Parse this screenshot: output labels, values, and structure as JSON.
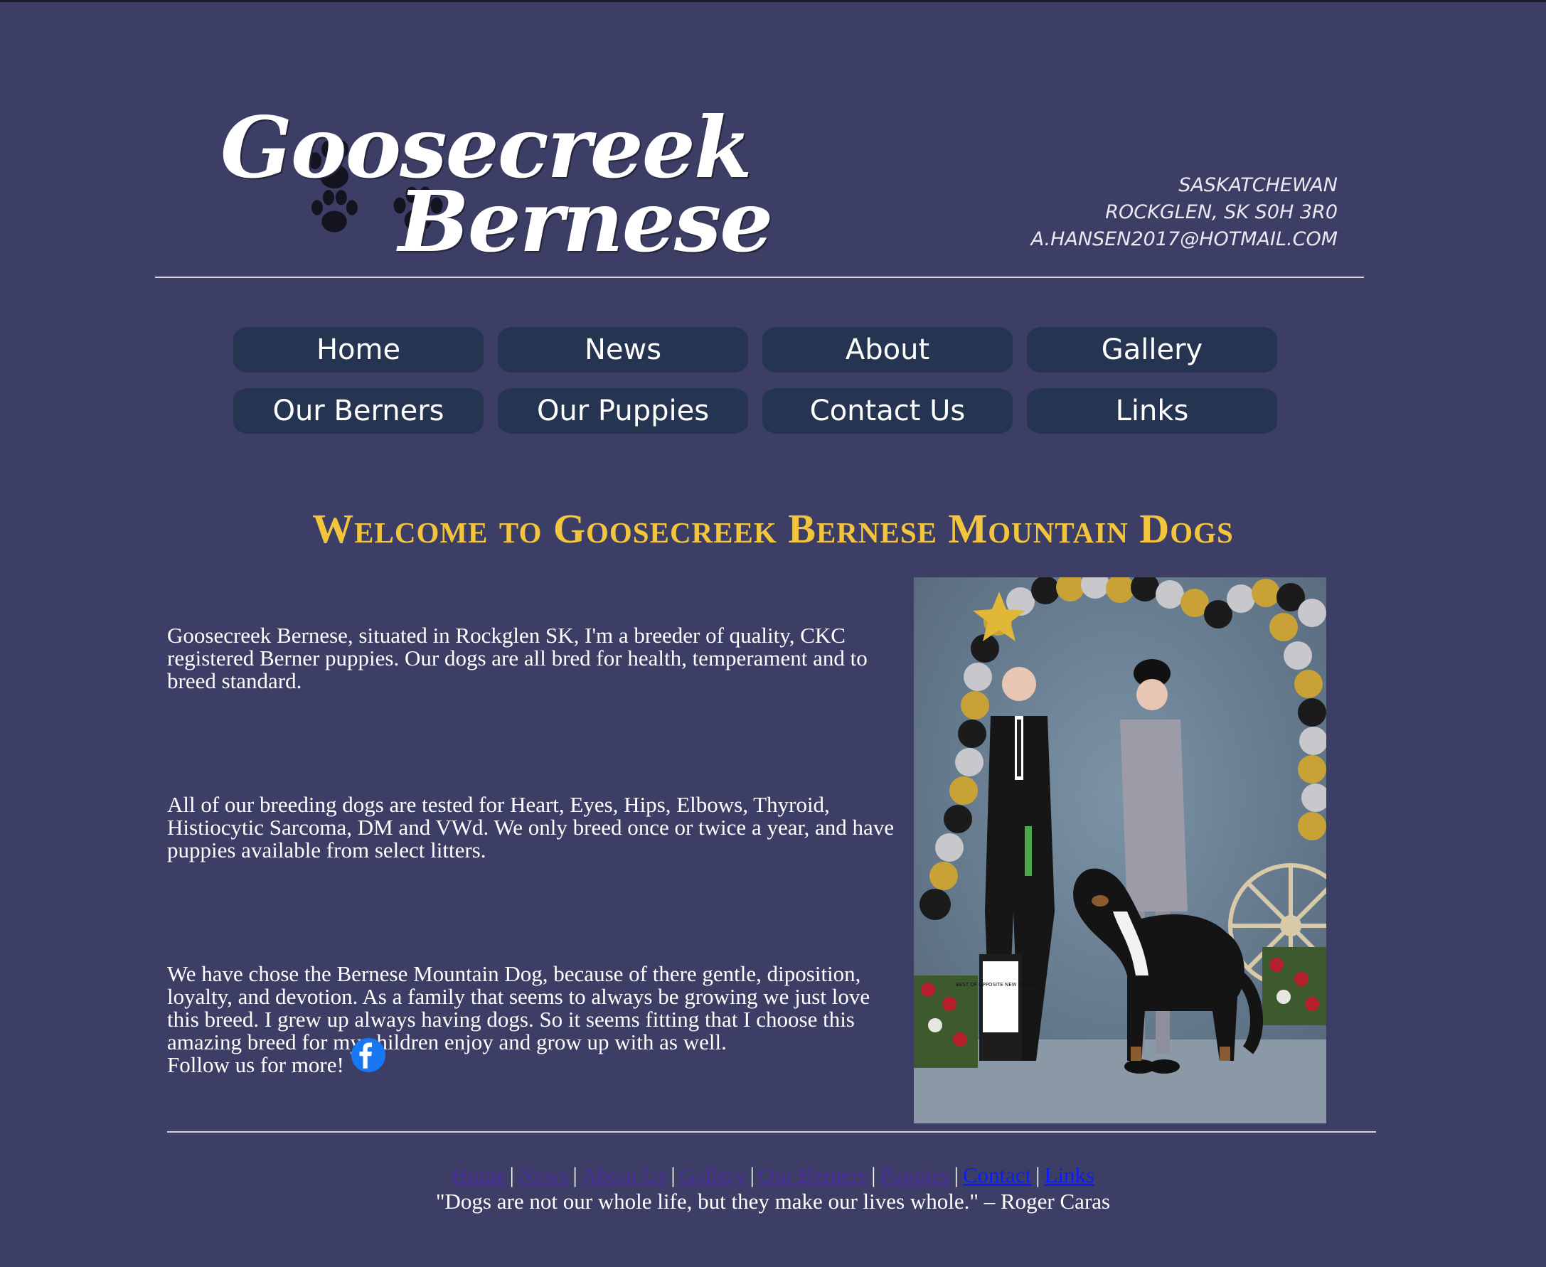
{
  "logo": {
    "line1": "Goosecreek",
    "line2": "Bernese",
    "paw_icon": "paw-print-icon"
  },
  "address": {
    "line1": "SASKATCHEWAN",
    "line2": "ROCKGLEN, SK S0H 3R0",
    "line3": "A.HANSEN2017@HOTMAIL.COM"
  },
  "nav": {
    "items": [
      {
        "label": "Home"
      },
      {
        "label": "News"
      },
      {
        "label": "About"
      },
      {
        "label": "Gallery"
      },
      {
        "label": "Our Berners"
      },
      {
        "label": "Our Puppies"
      },
      {
        "label": "Contact Us"
      },
      {
        "label": "Links"
      }
    ],
    "button_color": "#253450"
  },
  "main": {
    "heading": "Welcome to Goosecreek Bernese Mountain Dogs",
    "heading_color": "#f2c53d",
    "paragraphs": [
      "Goosecreek Bernese, situated in Rockglen SK, I'm a breeder of quality, CKC registered Berner puppies. Our dogs are all bred for health, temperament and to breed standard.",
      "All of our breeding dogs are tested for Heart, Eyes, Hips, Elbows, Thyroid, Histiocytic Sarcoma, DM and VWd. We only breed once or twice a year, and have puppies available from select litters.",
      "We have chose the Bernese Mountain Dog, because of there gentle, diposition, loyalty, and devotion. As a family that seems to always be growing we just love this breed. I grew up always having dogs. So it seems fitting that I choose this amazing breed for my children enjoy and grow up with as well."
    ],
    "follow_text": "Follow us for more!",
    "facebook_icon": "facebook-icon",
    "photo_sign_text": "BEST OF OPPOSITE NEW CHAMPION"
  },
  "footer": {
    "links": [
      {
        "label": "Home"
      },
      {
        "label": "News"
      },
      {
        "label": "About Us"
      },
      {
        "label": "Gallery"
      },
      {
        "label": "Our Berners"
      },
      {
        "label": "Puppies"
      },
      {
        "label": "Contact"
      },
      {
        "label": "Links"
      }
    ],
    "separator": "|",
    "quote": "\"Dogs are not our whole life, but they make our lives whole.\" – Roger Caras"
  },
  "colors": {
    "background": "#3c3e66",
    "visited_link": "#4a2c9b",
    "link": "#0b1cff"
  }
}
